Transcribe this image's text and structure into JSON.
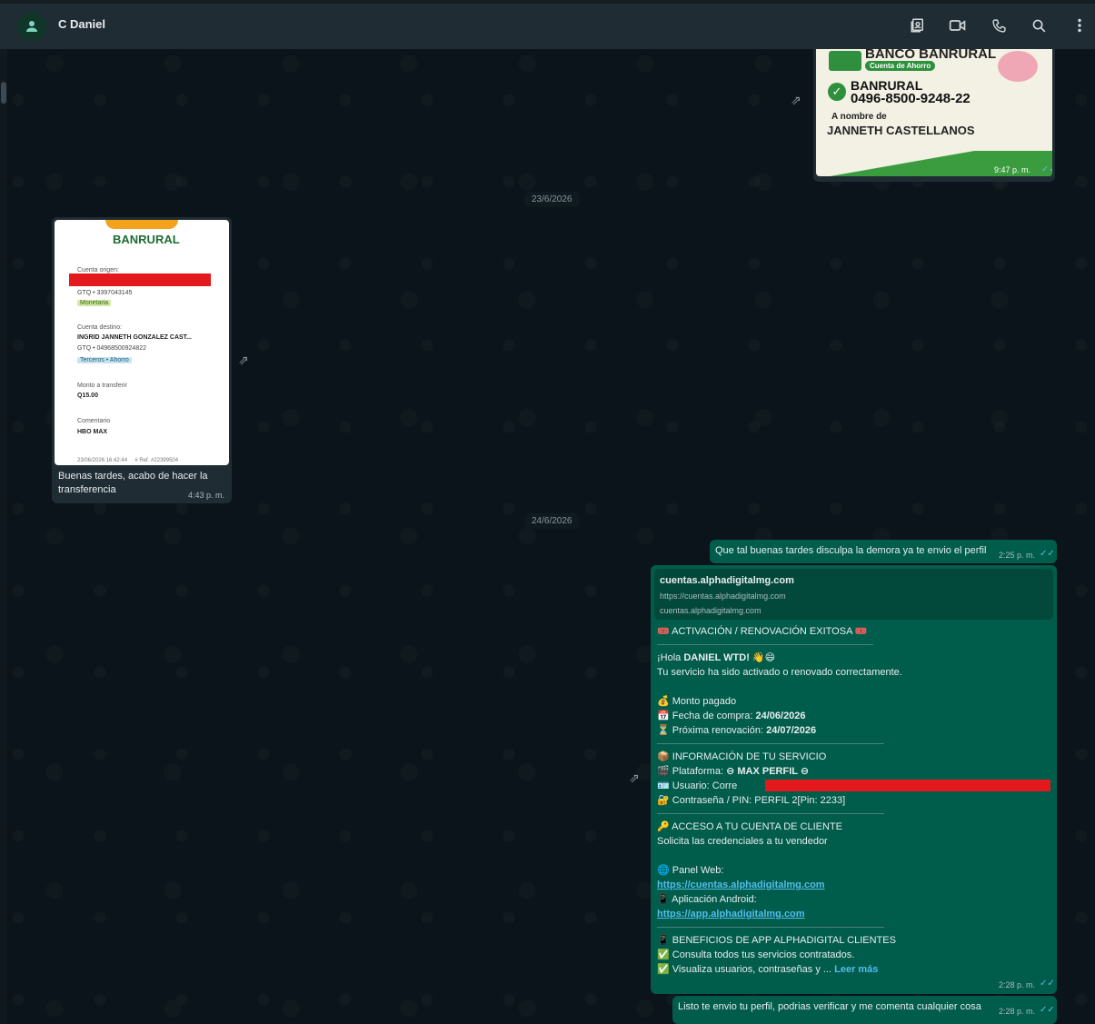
{
  "header": {
    "contact_name": "C Daniel"
  },
  "dates": {
    "chip1": "23/6/2026",
    "chip2": "24/6/2026"
  },
  "image_card_top": {
    "bank_title": "BANCO BANRURAL",
    "subtitle": "Cuenta de Ahorro",
    "bank_name": "BANRURAL",
    "account": "0496-8500-9248-22",
    "owner_label": "A nombre de",
    "owner_name": "JANNETH CASTELLANOS",
    "time": "9:47 p. m."
  },
  "receipt": {
    "logo": "BANRURAL",
    "origin_label": "Cuenta origen:",
    "origin_account": "GTQ • 3397043145",
    "origin_tag": "Monetaria",
    "dest_label": "Cuenta destino:",
    "dest_name": "INGRID JANNETH GONZALEZ CAST...",
    "dest_account": "GTQ • 04968500924822",
    "dest_tag": "Terceros • Ahorro",
    "amount_label": "Monto a transferir",
    "amount": "Q15.00",
    "comment_label": "Comentario",
    "comment": "HBO MAX",
    "footer": "23/06/2026 16:42:44     # Ref. #22399504",
    "caption": "Buenas tardes, acabo de hacer la transferencia",
    "time": "4:43 p. m."
  },
  "msg1": {
    "text": "Que tal buenas tardes disculpa la demora ya te envio el perfil",
    "time": "2:25 p. m."
  },
  "msg2": {
    "preview_title": "cuentas.alphadigitalmg.com",
    "preview_url": "https://cuentas.alphadigitalmg.com",
    "preview_domain": "cuentas.alphadigitalmg.com",
    "l1": "ACTIVACIÓN / RENOVACIÓN EXITOSA",
    "greet_pre": "¡Hola ",
    "greet_name": "DANIEL WTD!",
    "l3": "Tu servicio ha sido activado o renovado correctamente.",
    "l4": "Monto pagado",
    "l5_label": "Fecha de compra: ",
    "l5_value": "24/06/2026",
    "l6_label": "Próxima renovación: ",
    "l6_value": "24/07/2026",
    "l7": "INFORMACIÓN DE TU SERVICIO",
    "l8_label": "Plataforma: ",
    "l8_value": "MAX PERFIL",
    "l9": "Usuario: Corre",
    "l10": "Contraseña / PIN: PERFIL 2[Pin: 2233]",
    "l11": "ACCESO A TU CUENTA DE CLIENTE",
    "l12": "Solicita las credenciales a tu vendedor",
    "l13": "Panel Web:",
    "l14": "https://cuentas.alphadigitalmg.com",
    "l15": "Aplicación Android:",
    "l16": "https://app.alphadigitalmg.com",
    "l17": "BENEFICIOS DE APP ALPHADIGITAL CLIENTES",
    "l18": "Consulta todos tus servicios contratados.",
    "l19": "Visualiza usuarios, contraseñas y ...",
    "read_more": "Leer más",
    "time": "2:28 p. m."
  },
  "msg3": {
    "text": "Listo te envio tu perfil, podrias verificar y me comenta cualquier cosa",
    "time": "2:28 p. m."
  },
  "colors": {
    "header_bg": "#202c33",
    "outgoing_bubble": "#005c4b",
    "incoming_bubble": "#202c33",
    "read_ticks": "#53bdeb",
    "redaction": "#e3191e"
  },
  "icons": [
    "avatar-person-icon",
    "contact-card-icon",
    "video-call-icon",
    "phone-icon",
    "search-icon",
    "menu-dots-icon",
    "forward-icon",
    "double-check-icon"
  ]
}
